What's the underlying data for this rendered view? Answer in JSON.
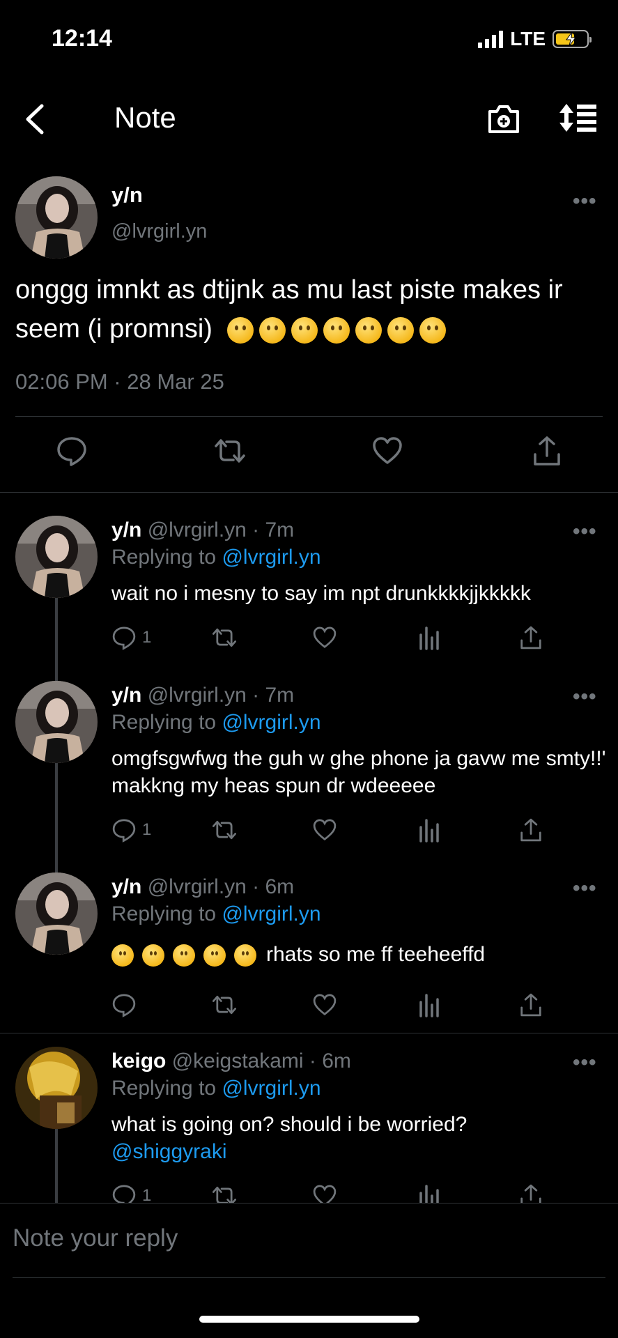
{
  "status_bar": {
    "time": "12:14",
    "network": "LTE"
  },
  "header": {
    "title": "Note"
  },
  "main_note": {
    "name": "y/n",
    "handle": "@lvrgirl.yn",
    "text": "onggg imnkt as dtijnk as mu last piste makes ir seem (i promnsi)",
    "timestamp": "02:06 PM · 28 Mar 25"
  },
  "replies": [
    {
      "name": "y/n",
      "meta": "@lvrgirl.yn · 7m",
      "replying_label": "Replying to",
      "replying_to": "@lvrgirl.yn",
      "text": "wait no i mesny to say im npt drunkkkkjjkkkkk",
      "reply_count": "1"
    },
    {
      "name": "y/n",
      "meta": "@lvrgirl.yn · 7m",
      "replying_label": "Replying to",
      "replying_to": "@lvrgirl.yn",
      "text": "omgfsgwfwg the guh w ghe phone ja gavw me smty!!' makkng my heas spun dr wdeeeee",
      "reply_count": "1"
    },
    {
      "name": "y/n",
      "meta": "@lvrgirl.yn · 6m",
      "replying_label": "Replying to",
      "replying_to": "@lvrgirl.yn",
      "text": "rhats so me ff teeheeffd",
      "reply_count": ""
    },
    {
      "name": "keigo",
      "meta": "@keigstakami · 6m",
      "replying_label": "Replying to",
      "replying_to": "@lvrgirl.yn",
      "text": "what is going on? should i be worried?",
      "mention": "@shiggyraki",
      "reply_count": "1"
    }
  ],
  "compose": {
    "placeholder": "Note your reply"
  },
  "colors": {
    "background": "#000000",
    "accent": "#1d9bf0",
    "muted": "#71767b",
    "battery": "#f5c518"
  }
}
